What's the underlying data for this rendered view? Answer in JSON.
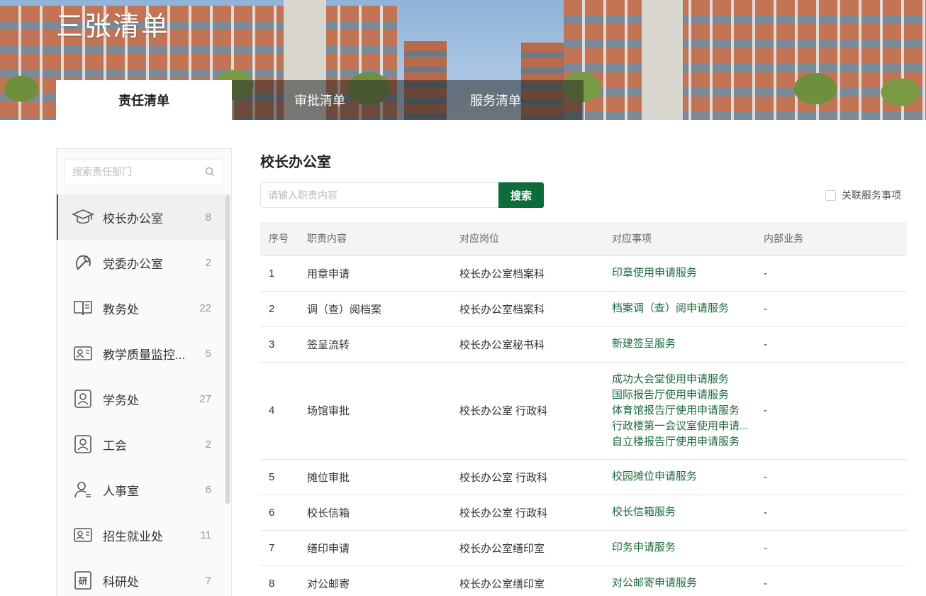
{
  "banner": {
    "title": "三张清单"
  },
  "tabs": [
    {
      "label": "责任清单",
      "active": true
    },
    {
      "label": "审批清单",
      "active": false
    },
    {
      "label": "服务清单",
      "active": false
    }
  ],
  "sidebar": {
    "search_placeholder": "搜索责任部门",
    "items": [
      {
        "label": "校长办公室",
        "count": "8",
        "icon": "graduation-cap-icon",
        "active": true
      },
      {
        "label": "党委办公室",
        "count": "2",
        "icon": "hammer-sickle-icon"
      },
      {
        "label": "教务处",
        "count": "22",
        "icon": "open-book-icon"
      },
      {
        "label": "教学质量监控...",
        "count": "5",
        "icon": "id-card-icon"
      },
      {
        "label": "学务处",
        "count": "27",
        "icon": "user-badge-icon"
      },
      {
        "label": "工会",
        "count": "2",
        "icon": "user-badge-icon"
      },
      {
        "label": "人事室",
        "count": "6",
        "icon": "user-list-icon"
      },
      {
        "label": "招生就业处",
        "count": "11",
        "icon": "id-card-icon"
      },
      {
        "label": "科研处",
        "count": "7",
        "icon": "research-icon"
      }
    ]
  },
  "main": {
    "title": "校长办公室",
    "search_placeholder": "请输入职责内容",
    "search_button": "搜索",
    "related_label": "关联服务事项",
    "columns": [
      "序号",
      "职责内容",
      "对应岗位",
      "对应事项",
      "内部业务"
    ],
    "rows": [
      {
        "no": "1",
        "content": "用章申请",
        "post": "校长办公室档案科",
        "services": [
          "印章使用申请服务"
        ],
        "internal": "-"
      },
      {
        "no": "2",
        "content": "调（查）阅档案",
        "post": "校长办公室档案科",
        "services": [
          "档案调（查）阅申请服务"
        ],
        "internal": "-"
      },
      {
        "no": "3",
        "content": "签呈流转",
        "post": "校长办公室秘书科",
        "services": [
          "新建签呈服务"
        ],
        "internal": "-"
      },
      {
        "no": "4",
        "content": "场馆审批",
        "post": "校长办公室 行政科",
        "services": [
          "成功大会堂使用申请服务",
          "国际报告厅使用申请服务",
          "体育馆报告厅使用申请服务",
          "行政楼第一会议室使用申请...",
          "自立楼报告厅使用申请服务"
        ],
        "internal": "-"
      },
      {
        "no": "5",
        "content": "摊位审批",
        "post": "校长办公室 行政科",
        "services": [
          "校园摊位申请服务"
        ],
        "internal": "-"
      },
      {
        "no": "6",
        "content": "校长信箱",
        "post": "校长办公室 行政科",
        "services": [
          "校长信箱服务"
        ],
        "internal": "-"
      },
      {
        "no": "7",
        "content": "缮印申请",
        "post": "校长办公室缮印室",
        "services": [
          "印务申请服务"
        ],
        "internal": "-"
      },
      {
        "no": "8",
        "content": "对公邮寄",
        "post": "校长办公室缮印室",
        "services": [
          "对公邮寄申请服务"
        ],
        "internal": "-"
      }
    ]
  },
  "colors": {
    "accent": "#0e6b3a",
    "link": "#1d6b3e"
  }
}
